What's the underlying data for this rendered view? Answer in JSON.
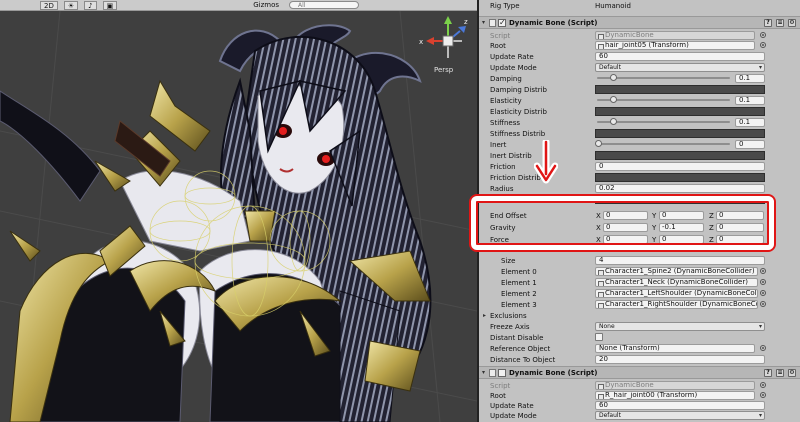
{
  "scene": {
    "toolbar": {
      "mode": "2D",
      "gizmos": "Gizmos",
      "search_placeholder": "All"
    },
    "gizmo_axis_x": "x",
    "gizmo_axis_z": "z",
    "persp": "Persp"
  },
  "inspector": {
    "rig_type": {
      "label": "Rig Type",
      "value": "Humanoid"
    },
    "component1": {
      "title": "Dynamic Bone (Script)",
      "enabled": true,
      "script": {
        "label": "Script",
        "value": "DynamicBone"
      },
      "root": {
        "label": "Root",
        "value": "hair_joint05 (Transform)"
      },
      "update_rate": {
        "label": "Update Rate",
        "value": "60"
      },
      "update_mode": {
        "label": "Update Mode",
        "value": "Default"
      },
      "damping": {
        "label": "Damping",
        "value": "0.1",
        "fraction": 0.1
      },
      "damping_distrib": {
        "label": "Damping Distrib"
      },
      "elasticity": {
        "label": "Elasticity",
        "value": "0.1",
        "fraction": 0.1
      },
      "elasticity_distrib": {
        "label": "Elasticity Distrib"
      },
      "stiffness": {
        "label": "Stiffness",
        "value": "0.1",
        "fraction": 0.1
      },
      "stiffness_distrib": {
        "label": "Stiffness Distrib"
      },
      "inert": {
        "label": "Inert",
        "value": "0",
        "fraction": 0
      },
      "inert_distrib": {
        "label": "Inert Distrib"
      },
      "friction": {
        "label": "Friction",
        "value": "0"
      },
      "friction_distrib": {
        "label": "Friction Distrib"
      },
      "radius": {
        "label": "Radius",
        "value": "0.02"
      },
      "radius_distrib": {
        "label": "Radius Distrib"
      },
      "end_offset": {
        "label": "End Offset",
        "x": "0",
        "y": "0",
        "z": "0"
      },
      "gravity": {
        "label": "Gravity",
        "x": "0",
        "y": "-0.1",
        "z": "0"
      },
      "force": {
        "label": "Force",
        "x": "0",
        "y": "0",
        "z": "0"
      },
      "axis_labels": {
        "x": "X",
        "y": "Y",
        "z": "Z"
      },
      "size": {
        "label": "Size",
        "value": "4"
      },
      "elements": [
        {
          "label": "Element 0",
          "value": "Character1_Spine2 (DynamicBoneCollider)"
        },
        {
          "label": "Element 1",
          "value": "Character1_Neck (DynamicBoneCollider)"
        },
        {
          "label": "Element 2",
          "value": "Character1_LeftShoulder (DynamicBoneCollider)"
        },
        {
          "label": "Element 3",
          "value": "Character1_RightShoulder (DynamicBoneCollider)"
        }
      ],
      "exclusions": {
        "label": "Exclusions"
      },
      "freeze_axis": {
        "label": "Freeze Axis",
        "value": "None"
      },
      "distant_disable": {
        "label": "Distant Disable",
        "checked": false
      },
      "reference_object": {
        "label": "Reference Object",
        "value": "None (Transform)"
      },
      "distance_to_object": {
        "label": "Distance To Object",
        "value": "20"
      }
    },
    "component2": {
      "title": "Dynamic Bone (Script)",
      "enabled": false,
      "script": {
        "label": "Script",
        "value": "DynamicBone"
      },
      "root": {
        "label": "Root",
        "value": "R_hair_joint00 (Transform)"
      },
      "update_rate": {
        "label": "Update Rate",
        "value": "60"
      },
      "update_mode": {
        "label": "Update Mode",
        "value": "Default"
      }
    }
  },
  "colors": {
    "annotation_red": "#e01515",
    "annotation_white": "#ffffff",
    "inspector_bg": "#c2c2c2",
    "scene_bg": "#3f3f3f"
  }
}
